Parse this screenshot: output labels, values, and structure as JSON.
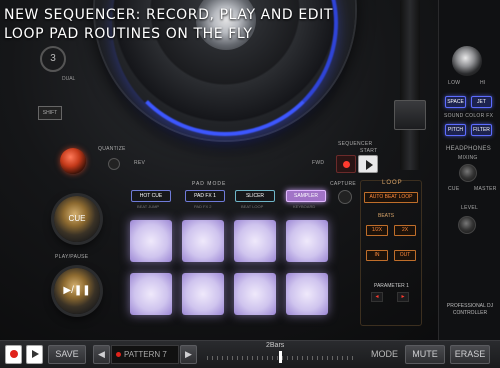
{
  "headline": {
    "line1": "NEW SEQUENCER: RECORD, PLAY AND EDIT",
    "line2": "LOOP PAD ROUTINES ON THE FLY"
  },
  "deck": {
    "deck_number": "3",
    "dual_label": "DUAL",
    "shift_label": "SHIFT",
    "quantize_label": "QUANTIZE",
    "cue_label": "CUE",
    "play_pause_label": "PLAY/PAUSE",
    "play_symbol": "▶/❚❚",
    "rev_label": "REV",
    "fwd_label": "FWD"
  },
  "sequencer": {
    "label": "SEQUENCER",
    "start_label": "START"
  },
  "pad_mode": {
    "title": "PAD MODE",
    "modes": [
      {
        "label": "HOT CUE",
        "sub": "BEAT JUMP"
      },
      {
        "label": "PAD FX 1",
        "sub": "PAD FX 2"
      },
      {
        "label": "SLICER",
        "sub": "BEAT LOOP"
      },
      {
        "label": "SAMPLER",
        "sub": "KEYBOARD"
      }
    ],
    "active_mode": "SAMPLER",
    "capture_label": "CAPTURE"
  },
  "loop": {
    "title": "LOOP",
    "auto_beat_label": "AUTO BEAT LOOP",
    "beats_label": "BEATS",
    "half_label": "1/2X",
    "double_label": "2X",
    "in_label": "IN",
    "out_label": "OUT",
    "parameter_label": "PARAMETER 1",
    "left_arrow": "◂",
    "right_arrow": "▸"
  },
  "right_strip": {
    "low_label": "LOW",
    "hi_label": "HI",
    "fx_buttons": [
      "SPACE",
      "JET",
      "PITCH",
      "FILTER"
    ],
    "sound_color_fx_label": "SOUND COLOR FX",
    "headphones_label": "HEADPHONES",
    "mixing_label": "MIXING",
    "cue_label": "CUE",
    "master_label": "MASTER",
    "level_label": "LEVEL",
    "product_label": "PROFESSIONAL DJ CONTROLLER"
  },
  "toolbar": {
    "save_label": "SAVE",
    "prev_label": "◀",
    "next_label": "▶",
    "pattern_label": "PATTERN 7",
    "bars_label": "2Bars",
    "mode_label": "MODE",
    "mute_label": "MUTE",
    "erase_label": "ERASE"
  },
  "colors": {
    "jog_glow": "#3d57ff",
    "pad_light": "#cfc4ee",
    "sampler_active": "#a173c7",
    "loop_accent": "#ff8a3c",
    "record_red": "#e0231b"
  }
}
